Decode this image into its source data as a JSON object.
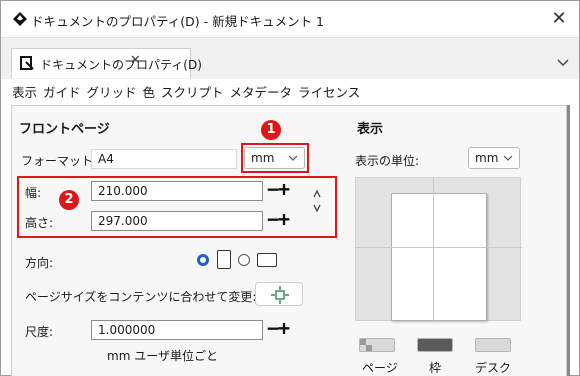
{
  "window": {
    "title": "ドキュメントのプロパティ(D) - 新規ドキュメント 1",
    "close_glyph": "✕",
    "app_icon": "inkscape-logo-icon"
  },
  "tab": {
    "label": "ドキュメントのプロパティ(D)",
    "close_glyph": "✕",
    "icon": "document-properties-icon",
    "strip_menu_glyph": "⌵"
  },
  "sections": [
    "表示",
    "ガイド",
    "グリッド",
    "色",
    "スクリプト",
    "メタデータ",
    "ライセンス"
  ],
  "front_page": {
    "heading": "フロントページ",
    "format_label": "フォーマット:",
    "format_value": "A4",
    "unit_value": "mm",
    "width_label": "幅:",
    "width_value": "210.000",
    "height_label": "高さ:",
    "height_value": "297.000",
    "orientation_label": "方向:",
    "resize_label": "ページサイズをコンテンツに合わせて変更:",
    "scale_label": "尺度:",
    "scale_value": "1.000000",
    "user_units_note": "mm ユーザ単位ごと",
    "spin_minus": "−",
    "spin_plus": "+"
  },
  "annotations": {
    "badge1": "1",
    "badge2": "2",
    "highlight_color": "#e0161c"
  },
  "display": {
    "heading": "表示",
    "display_units_label": "表示の単位:",
    "display_units_value": "mm",
    "swatch_labels": [
      "ページ",
      "枠",
      "デスク"
    ]
  },
  "colors": {
    "accent": "#1f5fbf",
    "swatch_page": "#d9d9d9",
    "swatch_border": "#5a5a5a",
    "swatch_desk": "#d9d9d9"
  }
}
